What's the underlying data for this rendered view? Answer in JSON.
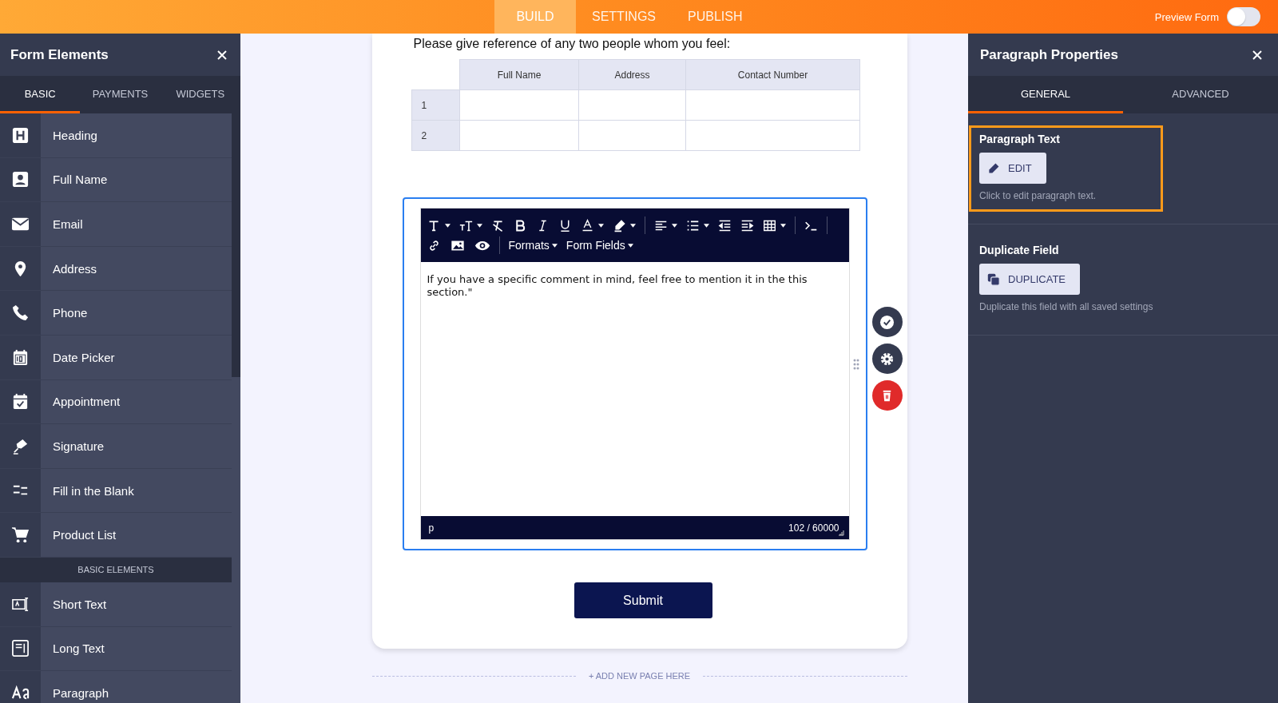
{
  "top_bar": {
    "tabs": [
      {
        "label": "BUILD",
        "selected": true
      },
      {
        "label": "SETTINGS",
        "selected": false
      },
      {
        "label": "PUBLISH",
        "selected": false
      }
    ],
    "preview": {
      "label": "Preview Form",
      "on": false
    }
  },
  "left_panel": {
    "title": "Form Elements",
    "tabs": [
      {
        "label": "BASIC",
        "selected": true
      },
      {
        "label": "PAYMENTS",
        "selected": false
      },
      {
        "label": "WIDGETS",
        "selected": false
      }
    ],
    "items": [
      {
        "kind": "item",
        "label": "Heading"
      },
      {
        "kind": "item",
        "label": "Full Name"
      },
      {
        "kind": "item",
        "label": "Email"
      },
      {
        "kind": "item",
        "label": "Address"
      },
      {
        "kind": "item",
        "label": "Phone"
      },
      {
        "kind": "item",
        "label": "Date Picker"
      },
      {
        "kind": "item",
        "label": "Appointment"
      },
      {
        "kind": "item",
        "label": "Signature"
      },
      {
        "kind": "item",
        "label": "Fill in the Blank"
      },
      {
        "kind": "item",
        "label": "Product List"
      },
      {
        "kind": "section",
        "label": "BASIC ELEMENTS"
      },
      {
        "kind": "item",
        "label": "Short Text"
      },
      {
        "kind": "item",
        "label": "Long Text"
      },
      {
        "kind": "item",
        "label": "Paragraph"
      }
    ]
  },
  "form": {
    "question": "Please give reference of any two people whom you feel:",
    "table": {
      "columns": [
        "Full Name",
        "Address",
        "Contact Number"
      ],
      "rows": [
        "1",
        "2"
      ]
    },
    "editor": {
      "menus": [
        "Formats",
        "Form Fields"
      ],
      "content": "If you have a specific comment in mind, feel free to mention it in the this section.\"",
      "path": "p",
      "count": "102 / 60000"
    },
    "submit": "Submit",
    "add_page": "+ ADD NEW PAGE HERE"
  },
  "right_panel": {
    "title": "Paragraph Properties",
    "tabs": [
      {
        "label": "GENERAL",
        "selected": true
      },
      {
        "label": "ADVANCED",
        "selected": false
      }
    ],
    "sections": [
      {
        "kind": "edit",
        "title": "Paragraph Text",
        "button": "EDIT",
        "hint": "Click to edit paragraph text.",
        "highlighted": true
      },
      {
        "kind": "duplicate",
        "title": "Duplicate Field",
        "button": "DUPLICATE",
        "hint": "Duplicate this field with all saved settings",
        "highlighted": false
      }
    ]
  }
}
